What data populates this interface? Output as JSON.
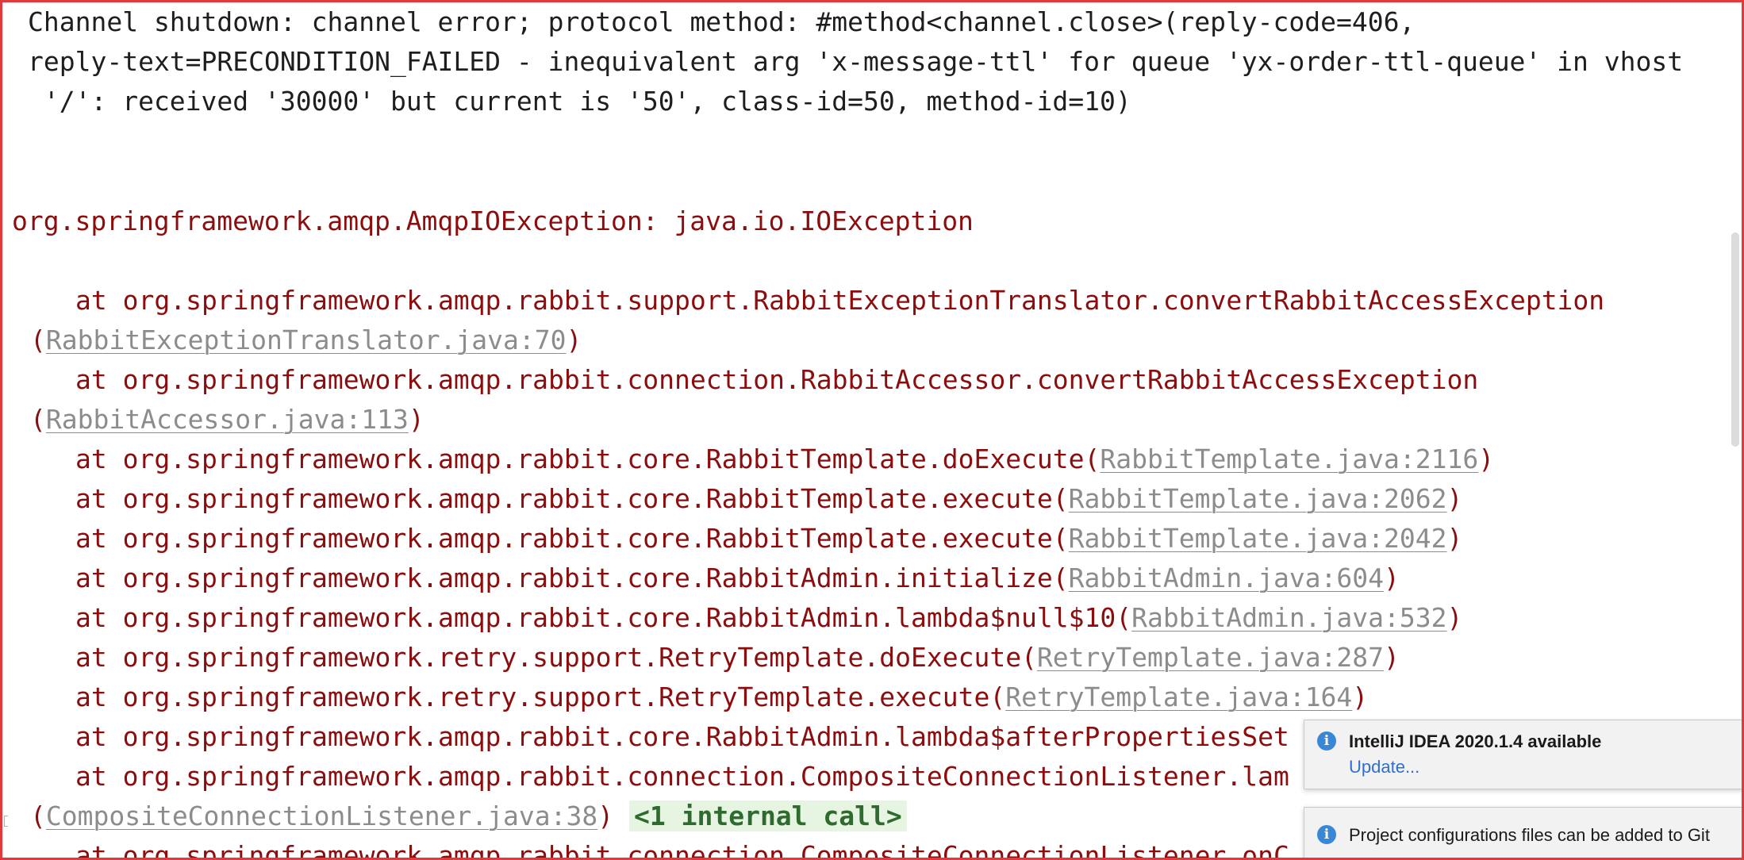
{
  "console": {
    "header": [
      "Channel shutdown: channel error; protocol method: #method<channel.close>(reply-code=406,",
      "reply-text=PRECONDITION_FAILED - inequivalent arg 'x-message-ttl' for queue 'yx-order-ttl-queue' in vhost",
      " '/': received '30000' but current is '50', class-id=50, method-id=10)"
    ],
    "exception": "org.springframework.amqp.AmqpIOException: java.io.IOException",
    "frames": [
      {
        "text": "at org.springframework.amqp.rabbit.support.RabbitExceptionTranslator.convertRabbitAccessException",
        "cont_open": "(",
        "link": "RabbitExceptionTranslator.java:70",
        "close": ")"
      },
      {
        "text": "at org.springframework.amqp.rabbit.connection.RabbitAccessor.convertRabbitAccessException",
        "cont_open": "(",
        "link": "RabbitAccessor.java:113",
        "close": ")"
      },
      {
        "text": "at org.springframework.amqp.rabbit.core.RabbitTemplate.doExecute(",
        "link": "RabbitTemplate.java:2116",
        "close": ")"
      },
      {
        "text": "at org.springframework.amqp.rabbit.core.RabbitTemplate.execute(",
        "link": "RabbitTemplate.java:2062",
        "close": ")"
      },
      {
        "text": "at org.springframework.amqp.rabbit.core.RabbitTemplate.execute(",
        "link": "RabbitTemplate.java:2042",
        "close": ")"
      },
      {
        "text": "at org.springframework.amqp.rabbit.core.RabbitAdmin.initialize(",
        "link": "RabbitAdmin.java:604",
        "close": ")"
      },
      {
        "text": "at org.springframework.amqp.rabbit.core.RabbitAdmin.lambda$null$10(",
        "link": "RabbitAdmin.java:532",
        "close": ")"
      },
      {
        "text": "at org.springframework.retry.support.RetryTemplate.doExecute(",
        "link": "RetryTemplate.java:287",
        "close": ")"
      },
      {
        "text": "at org.springframework.retry.support.RetryTemplate.execute(",
        "link": "RetryTemplate.java:164",
        "close": ")"
      },
      {
        "text": "at org.springframework.amqp.rabbit.core.RabbitAdmin.lambda$afterPropertiesSet"
      },
      {
        "text": "at org.springframework.amqp.rabbit.connection.CompositeConnectionListener.lam",
        "cont_open": "(",
        "link": "CompositeConnectionListener.java:38",
        "close": ")",
        "internal": "<1 internal call>"
      },
      {
        "text": "at org.springframework.amqp.rabbit.connection.CompositeConnectionListener.onC"
      }
    ]
  },
  "notifications": [
    {
      "title": "IntelliJ IDEA 2020.1.4 available",
      "action": "Update..."
    },
    {
      "text": "Project configurations files can be added to Git"
    }
  ],
  "colors": {
    "frame_border": "#e23a3a",
    "exception_text": "#8b0d0d",
    "link_text": "#8c8c8c",
    "internal_bg": "#e6f5e2",
    "info_icon": "#3a87d6",
    "notification_link": "#2f6fd1"
  },
  "icons": {
    "info": "i"
  }
}
